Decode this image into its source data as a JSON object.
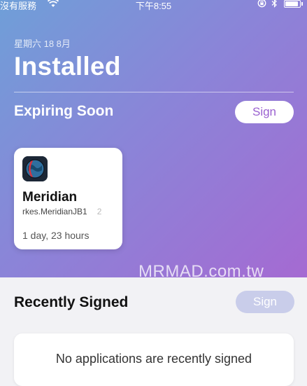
{
  "status_bar": {
    "carrier": "沒有服務",
    "time": "下午8:55"
  },
  "header": {
    "date": "星期六 18 8月",
    "title": "Installed"
  },
  "expiring": {
    "heading": "Expiring Soon",
    "sign_label": "Sign",
    "apps": [
      {
        "name": "Meridian",
        "bundle_id": "rkes.MeridianJB1",
        "bundle_id_tail": "2",
        "time_left": "1 day, 23 hours"
      }
    ]
  },
  "watermark": "MRMAD.com.tw",
  "recent": {
    "heading": "Recently Signed",
    "sign_label": "Sign",
    "empty_message": "No applications are recently signed"
  },
  "colors": {
    "accent": "#9a60d0",
    "gradient_start": "#6f9fd8",
    "gradient_end": "#a56ad2",
    "disabled_button": "#c9cdea"
  }
}
